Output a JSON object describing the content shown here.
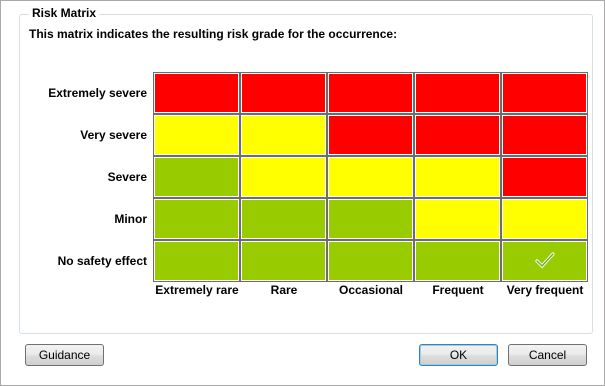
{
  "group_title": "Risk Matrix",
  "description": "This matrix indicates the resulting risk grade for the occurrence:",
  "rows": [
    {
      "label": "Extremely severe",
      "cells": [
        "#ff0000",
        "#ff0000",
        "#ff0000",
        "#ff0000",
        "#ff0000"
      ]
    },
    {
      "label": "Very severe",
      "cells": [
        "#ffff00",
        "#ffff00",
        "#ff0000",
        "#ff0000",
        "#ff0000"
      ]
    },
    {
      "label": "Severe",
      "cells": [
        "#99cc00",
        "#ffff00",
        "#ffff00",
        "#ffff00",
        "#ff0000"
      ]
    },
    {
      "label": "Minor",
      "cells": [
        "#99cc00",
        "#99cc00",
        "#99cc00",
        "#ffff00",
        "#ffff00"
      ]
    },
    {
      "label": "No safety effect",
      "cells": [
        "#99cc00",
        "#99cc00",
        "#99cc00",
        "#99cc00",
        "#99cc00"
      ]
    }
  ],
  "columns": [
    {
      "label": "Extremely rare"
    },
    {
      "label": "Rare"
    },
    {
      "label": "Occasional"
    },
    {
      "label": "Frequent"
    },
    {
      "label": "Very frequent"
    }
  ],
  "selected": {
    "row": 4,
    "column": 4,
    "icon": "check-icon"
  },
  "buttons": {
    "guidance": "Guidance",
    "ok": "OK",
    "cancel": "Cancel"
  }
}
